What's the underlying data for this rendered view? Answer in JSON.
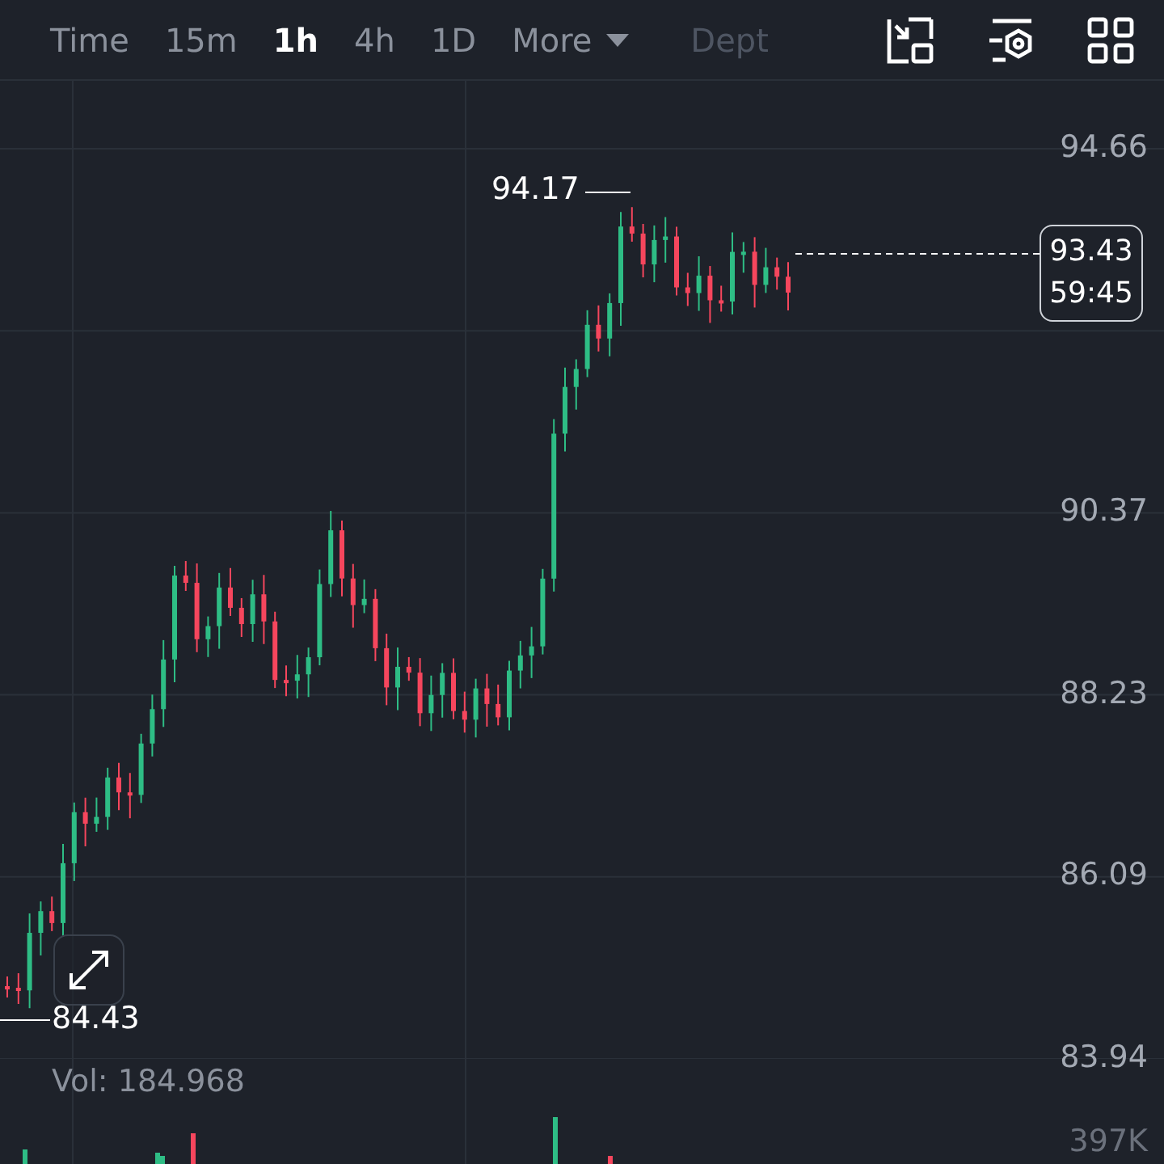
{
  "toolbar": {
    "tabs": [
      {
        "label": "Time",
        "selected": false
      },
      {
        "label": "15m",
        "selected": false
      },
      {
        "label": "1h",
        "selected": true
      },
      {
        "label": "4h",
        "selected": false
      },
      {
        "label": "1D",
        "selected": false
      }
    ],
    "more": {
      "label": "More"
    },
    "depth_tab": {
      "label": "Dept"
    }
  },
  "chart": {
    "price_labels": [
      "94.66",
      "90.37",
      "88.23",
      "86.09",
      "83.94"
    ],
    "high_marker": "94.17",
    "low_marker": "84.43",
    "current_price": {
      "price": "93.43",
      "countdown": "59:45"
    }
  },
  "volume": {
    "label": "Vol: 184.968",
    "axis_label": "397K"
  }
}
